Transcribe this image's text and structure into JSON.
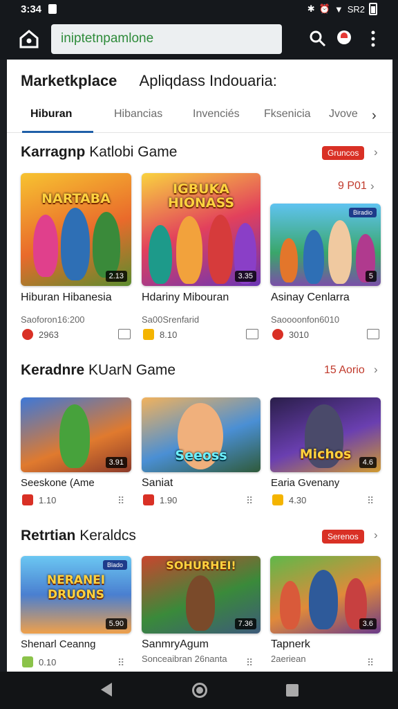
{
  "status": {
    "time": "3:34",
    "right": "SR2"
  },
  "browser": {
    "url": "iniptetnpamlone"
  },
  "header": {
    "title": "Marketkplace",
    "subtitle": "Apliqdass Indouaria:"
  },
  "tabs": [
    {
      "label": "Hiburan"
    },
    {
      "label": "Hibancias"
    },
    {
      "label": "Invenciés"
    },
    {
      "label": "Fksenicia"
    },
    {
      "label": "Jvove"
    }
  ],
  "sections": [
    {
      "title_bold": "Karragnp",
      "title_rest": "Katlobi Game",
      "pill": "Gruncos",
      "link": "9 P01",
      "cards": [
        {
          "art": "NARTABA",
          "badge": "2.13",
          "name": "Hiburan Hibanesia",
          "sub": "Saoforon16:200",
          "meta": "2963"
        },
        {
          "art": "IGBUKA HIONASS",
          "badge": "3.35",
          "name": "Hdariny Mibouran",
          "sub": "Sa00Srenfarid",
          "meta": "8.10"
        },
        {
          "art": "",
          "badge": "5",
          "corner": "Biradio",
          "name": "Asinay Cenlarra",
          "sub": "Saoooonfon6010",
          "meta": "3010"
        }
      ]
    },
    {
      "title_bold": "Keradnre",
      "title_rest": "KUarN Game",
      "link": "15 Aorio",
      "cards": [
        {
          "art": "",
          "badge": "3.91",
          "name": "Seeskone (Ame",
          "meta": "1.10"
        },
        {
          "art": "Seeoss",
          "badge": "",
          "name": "Saniat",
          "meta": "1.90"
        },
        {
          "art": "Michos",
          "badge": "4.6",
          "name": "Earia Gvenany",
          "meta": "4.30"
        }
      ]
    },
    {
      "title_bold": "Retrtian",
      "title_rest": "Keraldcs",
      "pill": "Serenos",
      "cards": [
        {
          "art": "NERANEI DRUONS",
          "badge": "5.90",
          "corner": "Blado",
          "name": "Shenarl Ceanng",
          "meta": "0.10"
        },
        {
          "art": "SOHURHEI!",
          "badge": "7.36",
          "name": "SanmryAgum",
          "sub": "Sonceaibran 26nanta",
          "meta": ""
        },
        {
          "art": "",
          "badge": "3.6",
          "name": "Tapnerk",
          "sub": "2aeriean",
          "meta": ""
        }
      ]
    }
  ]
}
